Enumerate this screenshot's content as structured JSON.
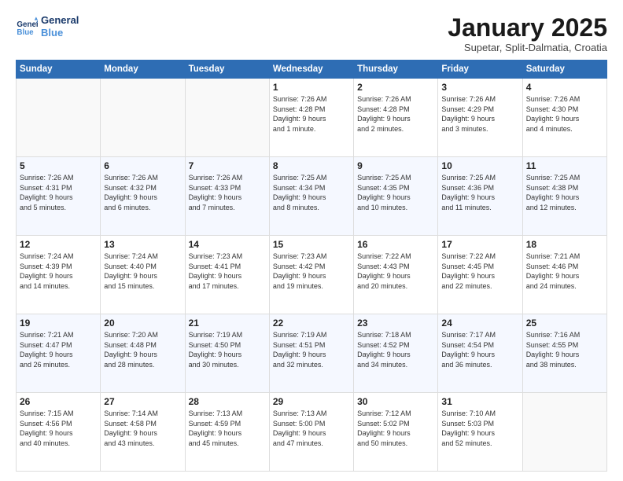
{
  "logo": {
    "line1": "General",
    "line2": "Blue"
  },
  "title": "January 2025",
  "subtitle": "Supetar, Split-Dalmatia, Croatia",
  "days_header": [
    "Sunday",
    "Monday",
    "Tuesday",
    "Wednesday",
    "Thursday",
    "Friday",
    "Saturday"
  ],
  "weeks": [
    [
      {
        "day": "",
        "info": ""
      },
      {
        "day": "",
        "info": ""
      },
      {
        "day": "",
        "info": ""
      },
      {
        "day": "1",
        "info": "Sunrise: 7:26 AM\nSunset: 4:28 PM\nDaylight: 9 hours\nand 1 minute."
      },
      {
        "day": "2",
        "info": "Sunrise: 7:26 AM\nSunset: 4:28 PM\nDaylight: 9 hours\nand 2 minutes."
      },
      {
        "day": "3",
        "info": "Sunrise: 7:26 AM\nSunset: 4:29 PM\nDaylight: 9 hours\nand 3 minutes."
      },
      {
        "day": "4",
        "info": "Sunrise: 7:26 AM\nSunset: 4:30 PM\nDaylight: 9 hours\nand 4 minutes."
      }
    ],
    [
      {
        "day": "5",
        "info": "Sunrise: 7:26 AM\nSunset: 4:31 PM\nDaylight: 9 hours\nand 5 minutes."
      },
      {
        "day": "6",
        "info": "Sunrise: 7:26 AM\nSunset: 4:32 PM\nDaylight: 9 hours\nand 6 minutes."
      },
      {
        "day": "7",
        "info": "Sunrise: 7:26 AM\nSunset: 4:33 PM\nDaylight: 9 hours\nand 7 minutes."
      },
      {
        "day": "8",
        "info": "Sunrise: 7:25 AM\nSunset: 4:34 PM\nDaylight: 9 hours\nand 8 minutes."
      },
      {
        "day": "9",
        "info": "Sunrise: 7:25 AM\nSunset: 4:35 PM\nDaylight: 9 hours\nand 10 minutes."
      },
      {
        "day": "10",
        "info": "Sunrise: 7:25 AM\nSunset: 4:36 PM\nDaylight: 9 hours\nand 11 minutes."
      },
      {
        "day": "11",
        "info": "Sunrise: 7:25 AM\nSunset: 4:38 PM\nDaylight: 9 hours\nand 12 minutes."
      }
    ],
    [
      {
        "day": "12",
        "info": "Sunrise: 7:24 AM\nSunset: 4:39 PM\nDaylight: 9 hours\nand 14 minutes."
      },
      {
        "day": "13",
        "info": "Sunrise: 7:24 AM\nSunset: 4:40 PM\nDaylight: 9 hours\nand 15 minutes."
      },
      {
        "day": "14",
        "info": "Sunrise: 7:23 AM\nSunset: 4:41 PM\nDaylight: 9 hours\nand 17 minutes."
      },
      {
        "day": "15",
        "info": "Sunrise: 7:23 AM\nSunset: 4:42 PM\nDaylight: 9 hours\nand 19 minutes."
      },
      {
        "day": "16",
        "info": "Sunrise: 7:22 AM\nSunset: 4:43 PM\nDaylight: 9 hours\nand 20 minutes."
      },
      {
        "day": "17",
        "info": "Sunrise: 7:22 AM\nSunset: 4:45 PM\nDaylight: 9 hours\nand 22 minutes."
      },
      {
        "day": "18",
        "info": "Sunrise: 7:21 AM\nSunset: 4:46 PM\nDaylight: 9 hours\nand 24 minutes."
      }
    ],
    [
      {
        "day": "19",
        "info": "Sunrise: 7:21 AM\nSunset: 4:47 PM\nDaylight: 9 hours\nand 26 minutes."
      },
      {
        "day": "20",
        "info": "Sunrise: 7:20 AM\nSunset: 4:48 PM\nDaylight: 9 hours\nand 28 minutes."
      },
      {
        "day": "21",
        "info": "Sunrise: 7:19 AM\nSunset: 4:50 PM\nDaylight: 9 hours\nand 30 minutes."
      },
      {
        "day": "22",
        "info": "Sunrise: 7:19 AM\nSunset: 4:51 PM\nDaylight: 9 hours\nand 32 minutes."
      },
      {
        "day": "23",
        "info": "Sunrise: 7:18 AM\nSunset: 4:52 PM\nDaylight: 9 hours\nand 34 minutes."
      },
      {
        "day": "24",
        "info": "Sunrise: 7:17 AM\nSunset: 4:54 PM\nDaylight: 9 hours\nand 36 minutes."
      },
      {
        "day": "25",
        "info": "Sunrise: 7:16 AM\nSunset: 4:55 PM\nDaylight: 9 hours\nand 38 minutes."
      }
    ],
    [
      {
        "day": "26",
        "info": "Sunrise: 7:15 AM\nSunset: 4:56 PM\nDaylight: 9 hours\nand 40 minutes."
      },
      {
        "day": "27",
        "info": "Sunrise: 7:14 AM\nSunset: 4:58 PM\nDaylight: 9 hours\nand 43 minutes."
      },
      {
        "day": "28",
        "info": "Sunrise: 7:13 AM\nSunset: 4:59 PM\nDaylight: 9 hours\nand 45 minutes."
      },
      {
        "day": "29",
        "info": "Sunrise: 7:13 AM\nSunset: 5:00 PM\nDaylight: 9 hours\nand 47 minutes."
      },
      {
        "day": "30",
        "info": "Sunrise: 7:12 AM\nSunset: 5:02 PM\nDaylight: 9 hours\nand 50 minutes."
      },
      {
        "day": "31",
        "info": "Sunrise: 7:10 AM\nSunset: 5:03 PM\nDaylight: 9 hours\nand 52 minutes."
      },
      {
        "day": "",
        "info": ""
      }
    ]
  ]
}
